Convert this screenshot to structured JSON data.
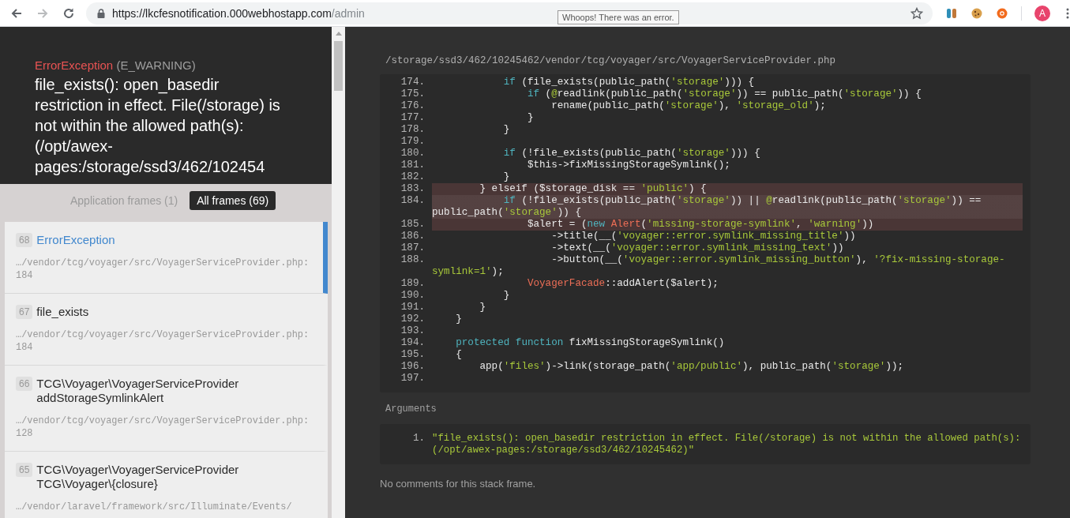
{
  "browser": {
    "url_host": "https://lkcfesnotification.000webhostapp.com",
    "url_path": "/admin",
    "forward_disabled": true,
    "tooltip": "Whoops! There was an error.",
    "avatar": "A"
  },
  "error": {
    "type": "ErrorException",
    "code": "(E_WARNING)",
    "message": "file_exists(): open_basedir restriction in effect. File(/storage) is not within the allowed path(s): (/opt/awex-pages:/storage/ssd3/462/102454"
  },
  "frame_tabs": [
    {
      "label": "Application frames (1)",
      "selected": false
    },
    {
      "label": "All frames (69)",
      "selected": true
    }
  ],
  "frames": [
    {
      "index": "68",
      "name": "ErrorException",
      "file": "…/vendor/tcg/voyager/src/VoyagerServiceProvider.php:184",
      "selected": true
    },
    {
      "index": "67",
      "name": "file_exists",
      "file": "…/vendor/tcg/voyager/src/VoyagerServiceProvider.php:184",
      "selected": false
    },
    {
      "index": "66",
      "name": "TCG\\Voyager\\VoyagerServiceProvider addStorageSymlinkAlert",
      "file": "…/vendor/tcg/voyager/src/VoyagerServiceProvider.php:128",
      "selected": false
    },
    {
      "index": "65",
      "name": "TCG\\Voyager\\VoyagerServiceProvider TCG\\Voyager\\{closure}",
      "file": "…/vendor/laravel/framework/src/Illuminate/Events/",
      "selected": false
    }
  ],
  "code": {
    "file_path": "/storage/ssd3/462/10245462/vendor/tcg/voyager/src/VoyagerServiceProvider.php",
    "lines": [
      {
        "number": "174.",
        "highlighted": false,
        "current": false,
        "tokens": [
          {
            "kind": "keyword",
            "text": "            if"
          },
          {
            "kind": "plain",
            "text": " (file_exists(public_path("
          },
          {
            "kind": "string",
            "text": "'storage'"
          },
          {
            "kind": "plain",
            "text": "))) {"
          }
        ]
      },
      {
        "number": "175.",
        "highlighted": false,
        "current": false,
        "tokens": [
          {
            "kind": "keyword",
            "text": "                if"
          },
          {
            "kind": "plain",
            "text": " ("
          },
          {
            "kind": "operator",
            "text": "@"
          },
          {
            "kind": "plain",
            "text": "readlink(public_path("
          },
          {
            "kind": "string",
            "text": "'storage'"
          },
          {
            "kind": "plain",
            "text": ")) == public_path("
          },
          {
            "kind": "string",
            "text": "'storage'"
          },
          {
            "kind": "plain",
            "text": ")) {"
          }
        ]
      },
      {
        "number": "176.",
        "highlighted": false,
        "current": false,
        "tokens": [
          {
            "kind": "plain",
            "text": "                    rename(public_path("
          },
          {
            "kind": "string",
            "text": "'storage'"
          },
          {
            "kind": "plain",
            "text": "), "
          },
          {
            "kind": "string",
            "text": "'storage_old'"
          },
          {
            "kind": "plain",
            "text": ");"
          }
        ]
      },
      {
        "number": "177.",
        "highlighted": false,
        "current": false,
        "tokens": [
          {
            "kind": "plain",
            "text": "                }"
          }
        ]
      },
      {
        "number": "178.",
        "highlighted": false,
        "current": false,
        "tokens": [
          {
            "kind": "plain",
            "text": "            }"
          }
        ]
      },
      {
        "number": "179.",
        "highlighted": false,
        "current": false
      },
      {
        "number": "180.",
        "highlighted": false,
        "current": false,
        "tokens": [
          {
            "kind": "keyword",
            "text": "            if"
          },
          {
            "kind": "plain",
            "text": " (!file_exists(public_path("
          },
          {
            "kind": "string",
            "text": "'storage'"
          },
          {
            "kind": "plain",
            "text": "))) {"
          }
        ]
      },
      {
        "number": "181.",
        "highlighted": false,
        "current": false,
        "tokens": [
          {
            "kind": "plain",
            "text": "                $this->fixMissingStorageSymlink();"
          }
        ]
      },
      {
        "number": "182.",
        "highlighted": false,
        "current": false,
        "tokens": [
          {
            "kind": "plain",
            "text": "            }"
          }
        ]
      },
      {
        "number": "183.",
        "highlighted": true,
        "current": false,
        "tokens": [
          {
            "kind": "plain",
            "text": "        } elseif ($storage_disk == "
          },
          {
            "kind": "string",
            "text": "'public'"
          },
          {
            "kind": "plain",
            "text": ") {"
          }
        ]
      },
      {
        "number": "184.",
        "highlighted": true,
        "current": true,
        "tokens": [
          {
            "kind": "keyword",
            "text": "            if"
          },
          {
            "kind": "plain",
            "text": " (!file_exists(public_path("
          },
          {
            "kind": "string",
            "text": "'storage'"
          },
          {
            "kind": "plain",
            "text": ")) || "
          },
          {
            "kind": "operator",
            "text": "@"
          },
          {
            "kind": "plain",
            "text": "readlink(public_path("
          },
          {
            "kind": "string",
            "text": "'storage'"
          },
          {
            "kind": "plain",
            "text": ")) == public_path("
          },
          {
            "kind": "string",
            "text": "'storage'"
          },
          {
            "kind": "plain",
            "text": ")) {"
          }
        ]
      },
      {
        "number": "185.",
        "highlighted": true,
        "current": false,
        "tokens": [
          {
            "kind": "plain",
            "text": "                $alert = ("
          },
          {
            "kind": "keyword",
            "text": "new"
          },
          {
            "kind": "class",
            "text": " Alert"
          },
          {
            "kind": "plain",
            "text": "("
          },
          {
            "kind": "string",
            "text": "'missing-storage-symlink'"
          },
          {
            "kind": "plain",
            "text": ", "
          },
          {
            "kind": "string",
            "text": "'warning'"
          },
          {
            "kind": "plain",
            "text": "))"
          }
        ]
      },
      {
        "number": "186.",
        "highlighted": false,
        "current": false,
        "tokens": [
          {
            "kind": "plain",
            "text": "                    ->title(__("
          },
          {
            "kind": "string",
            "text": "'voyager::error.symlink_missing_title'"
          },
          {
            "kind": "plain",
            "text": "))"
          }
        ]
      },
      {
        "number": "187.",
        "highlighted": false,
        "current": false,
        "tokens": [
          {
            "kind": "plain",
            "text": "                    ->text(__("
          },
          {
            "kind": "string",
            "text": "'voyager::error.symlink_missing_text'"
          },
          {
            "kind": "plain",
            "text": "))"
          }
        ]
      },
      {
        "number": "188.",
        "highlighted": false,
        "current": false,
        "tokens": [
          {
            "kind": "plain",
            "text": "                    ->button(__("
          },
          {
            "kind": "string",
            "text": "'voyager::error.symlink_missing_button'"
          },
          {
            "kind": "plain",
            "text": "), "
          },
          {
            "kind": "string",
            "text": "'?fix-missing-storage-symlink=1'"
          },
          {
            "kind": "plain",
            "text": ");"
          }
        ]
      },
      {
        "number": "189.",
        "highlighted": false,
        "current": false,
        "tokens": [
          {
            "kind": "class",
            "text": "                VoyagerFacade"
          },
          {
            "kind": "plain",
            "text": "::addAlert($alert);"
          }
        ]
      },
      {
        "number": "190.",
        "highlighted": false,
        "current": false,
        "tokens": [
          {
            "kind": "plain",
            "text": "            }"
          }
        ]
      },
      {
        "number": "191.",
        "highlighted": false,
        "current": false,
        "tokens": [
          {
            "kind": "plain",
            "text": "        }"
          }
        ]
      },
      {
        "number": "192.",
        "highlighted": false,
        "current": false,
        "tokens": [
          {
            "kind": "plain",
            "text": "    }"
          }
        ]
      },
      {
        "number": "193.",
        "highlighted": false,
        "current": false
      },
      {
        "number": "194.",
        "highlighted": false,
        "current": false,
        "tokens": [
          {
            "kind": "keyword",
            "text": "    protected"
          },
          {
            "kind": "keyword",
            "text": " function"
          },
          {
            "kind": "plain",
            "text": " fixMissingStorageSymlink()"
          }
        ]
      },
      {
        "number": "195.",
        "highlighted": false,
        "current": false,
        "tokens": [
          {
            "kind": "plain",
            "text": "    {"
          }
        ]
      },
      {
        "number": "196.",
        "highlighted": false,
        "current": false,
        "tokens": [
          {
            "kind": "plain",
            "text": "        app("
          },
          {
            "kind": "string",
            "text": "'files'"
          },
          {
            "kind": "plain",
            "text": ")->link(storage_path("
          },
          {
            "kind": "string",
            "text": "'app/public'"
          },
          {
            "kind": "plain",
            "text": "), public_path("
          },
          {
            "kind": "string",
            "text": "'storage'"
          },
          {
            "kind": "plain",
            "text": "));"
          }
        ]
      },
      {
        "number": "197.",
        "highlighted": false,
        "current": false
      }
    ]
  },
  "arguments": {
    "label": "Arguments",
    "items": [
      {
        "number": "1.",
        "value": "\"file_exists(): open_basedir restriction in effect. File(/storage) is not within the allowed path(s): (/opt/awex-pages:/storage/ssd3/462/10245462)\""
      }
    ]
  },
  "comments": "No comments for this stack frame."
}
